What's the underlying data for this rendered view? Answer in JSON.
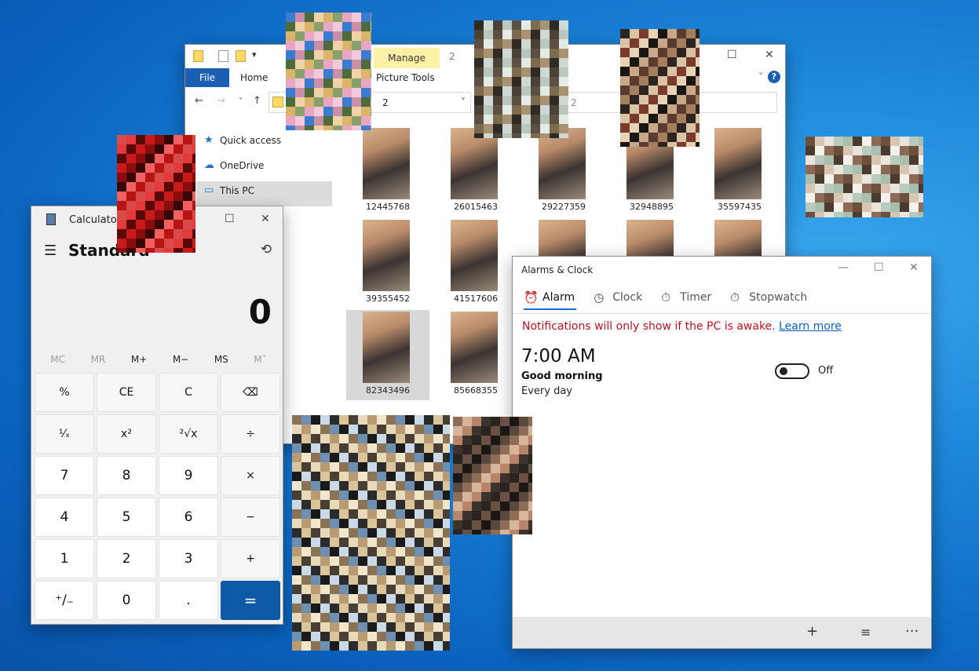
{
  "explorer": {
    "title": "2",
    "contextual_tab": "Manage",
    "tabs": {
      "file": "File",
      "home": "Home",
      "picture_tools": "Picture Tools"
    },
    "address_path": "2",
    "search_placeholder": "2",
    "nav": [
      {
        "label": "Quick access",
        "icon": "star-pin-icon"
      },
      {
        "label": "OneDrive",
        "icon": "cloud-icon"
      },
      {
        "label": "This PC",
        "icon": "computer-icon"
      }
    ],
    "files": [
      "12445768",
      "26015463",
      "29227359",
      "32948895",
      "35597435",
      "39355452",
      "41517606",
      "",
      "",
      "",
      "82343496",
      "85668355"
    ],
    "selected_file": "82343496"
  },
  "calculator": {
    "title": "Calculator",
    "mode": "Standard",
    "display": "0",
    "memory": [
      "MC",
      "MR",
      "M+",
      "M−",
      "MS",
      "M˅"
    ],
    "keys": [
      "%",
      "CE",
      "C",
      "⌫",
      "¹⁄ₓ",
      "x²",
      "²√x",
      "÷",
      "7",
      "8",
      "9",
      "×",
      "4",
      "5",
      "6",
      "−",
      "1",
      "2",
      "3",
      "+",
      "⁺/₋",
      "0",
      ".",
      "="
    ]
  },
  "alarms": {
    "title": "Alarms & Clock",
    "tabs": [
      "Alarm",
      "Clock",
      "Timer",
      "Stopwatch"
    ],
    "active_tab": "Alarm",
    "notice": "Notifications will only show if the PC is awake.",
    "notice_link": "Learn more",
    "alarm": {
      "time": "7:00 AM",
      "name": "Good morning",
      "repeat": "Every day",
      "state": "Off"
    },
    "bottom_actions": [
      "+",
      "≡",
      "···"
    ]
  },
  "colors": {
    "desktop": "#1c86d8",
    "accent": "#0f5aa8",
    "warning": "#c50f1f"
  }
}
